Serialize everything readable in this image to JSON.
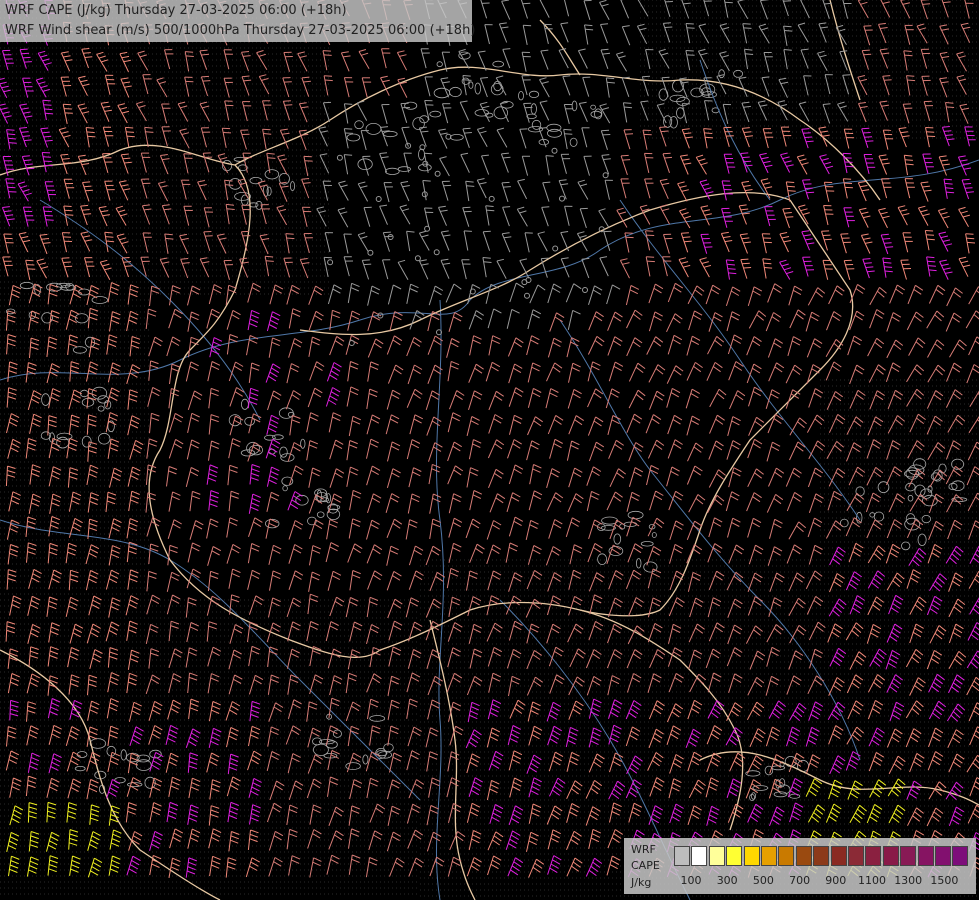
{
  "header": {
    "title_line1": "WRF CAPE (J/kg) Thursday 27-03-2025 06:00 (+18h)",
    "title_line2": "WRF Wind shear (m/s) 500/1000hPa Thursday 27-03-2025 06:00 (+18h)"
  },
  "legend": {
    "label_line1": "WRF",
    "label_line2": "CAPE",
    "label_line3": "J/kg",
    "colors": [
      "#bdbdbd",
      "#ffffff",
      "#ffff9a",
      "#ffff33",
      "#ffd700",
      "#e6a000",
      "#c97a00",
      "#9a4a10",
      "#8c3a1a",
      "#8a2a22",
      "#8b2a36",
      "#8a2040",
      "#891a48",
      "#881a55",
      "#861462",
      "#82106f",
      "#7d0d7a"
    ],
    "ticks": [
      "100",
      "300",
      "500",
      "700",
      "900",
      "1100",
      "1300",
      "1500"
    ]
  },
  "map": {
    "colors": {
      "background": "#000000",
      "border": "#e8c9a3",
      "river": "#4f77a8",
      "barb_weak": "#9a9a9a",
      "barb_medium": "#d77c76",
      "barb_strong": "#f08878",
      "barb_very_strong": "#e020e0",
      "barb_extreme": "#f0f020",
      "contour": "#a8a8a8"
    }
  }
}
